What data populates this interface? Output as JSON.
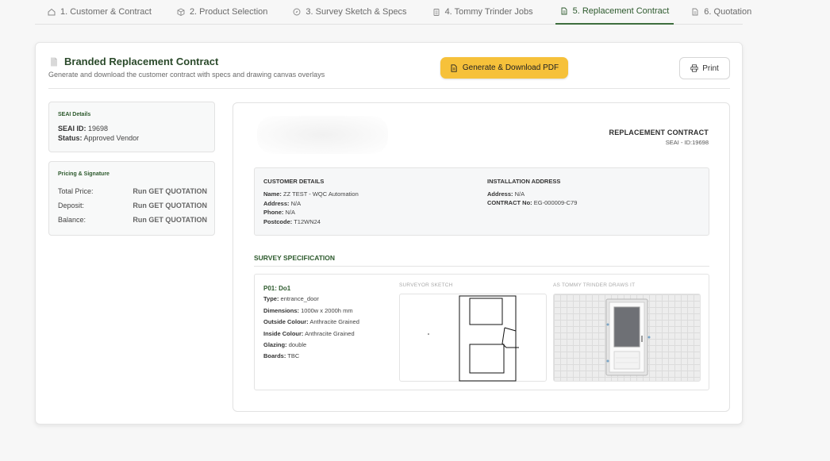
{
  "tabs": [
    {
      "label": "1. Customer & Contract",
      "icon": "home-icon"
    },
    {
      "label": "2. Product Selection",
      "icon": "box-icon"
    },
    {
      "label": "3. Survey Sketch & Specs",
      "icon": "compass-icon"
    },
    {
      "label": "4. Tommy Trinder Jobs",
      "icon": "clipboard-icon"
    },
    {
      "label": "5. Replacement Contract",
      "icon": "document-icon",
      "active": true
    },
    {
      "label": "6. Quotation",
      "icon": "document-icon"
    }
  ],
  "header": {
    "title": "Branded Replacement Contract",
    "subtitle": "Generate and download the customer contract with specs and drawing canvas overlays",
    "pdf_button": "Generate & Download PDF",
    "print_button": "Print"
  },
  "seai": {
    "title": "SEAI Details",
    "id_label": "SEAI ID:",
    "id_value": "19698",
    "status_label": "Status:",
    "status_value": "Approved Vendor"
  },
  "pricing": {
    "title": "Pricing & Signature",
    "rows": [
      {
        "label": "Total Price:",
        "value": "Run GET QUOTATION"
      },
      {
        "label": "Deposit:",
        "value": "Run GET QUOTATION"
      },
      {
        "label": "Balance:",
        "value": "Run GET QUOTATION"
      }
    ]
  },
  "contract": {
    "title": "REPLACEMENT CONTRACT",
    "seai_line": "SEAI - ID:19698",
    "customer": {
      "heading": "CUSTOMER DETAILS",
      "name_label": "Name:",
      "name_value": "ZZ TEST - WQC Automation",
      "address_label": "Address:",
      "address_value": "N/A",
      "phone_label": "Phone:",
      "phone_value": "N/A",
      "postcode_label": "Postcode:",
      "postcode_value": "T12WN24"
    },
    "installation": {
      "heading": "INSTALLATION ADDRESS",
      "address_label": "Address:",
      "address_value": "N/A",
      "contract_label": "CONTRACT No:",
      "contract_value": "EG-000009-C79"
    },
    "survey": {
      "heading": "SURVEY SPECIFICATION",
      "item_id": "P01: Do1",
      "type_label": "Type:",
      "type_value": "entrance_door",
      "dim_label": "Dimensions:",
      "dim_value": "1000w x 2000h mm",
      "outside_label": "Outside Colour:",
      "outside_value": "Anthracite Grained",
      "inside_label": "Inside Colour:",
      "inside_value": "Anthracite Grained",
      "glazing_label": "Glazing:",
      "glazing_value": "double",
      "boards_label": "Boards:",
      "boards_value": "TBC",
      "sketch_caption": "SURVEYOR SKETCH",
      "render_caption": "AS TOMMY TRINDER DRAWS IT"
    }
  },
  "colors": {
    "accent_green": "#2d5a2d",
    "button_yellow": "#f6c13a"
  }
}
